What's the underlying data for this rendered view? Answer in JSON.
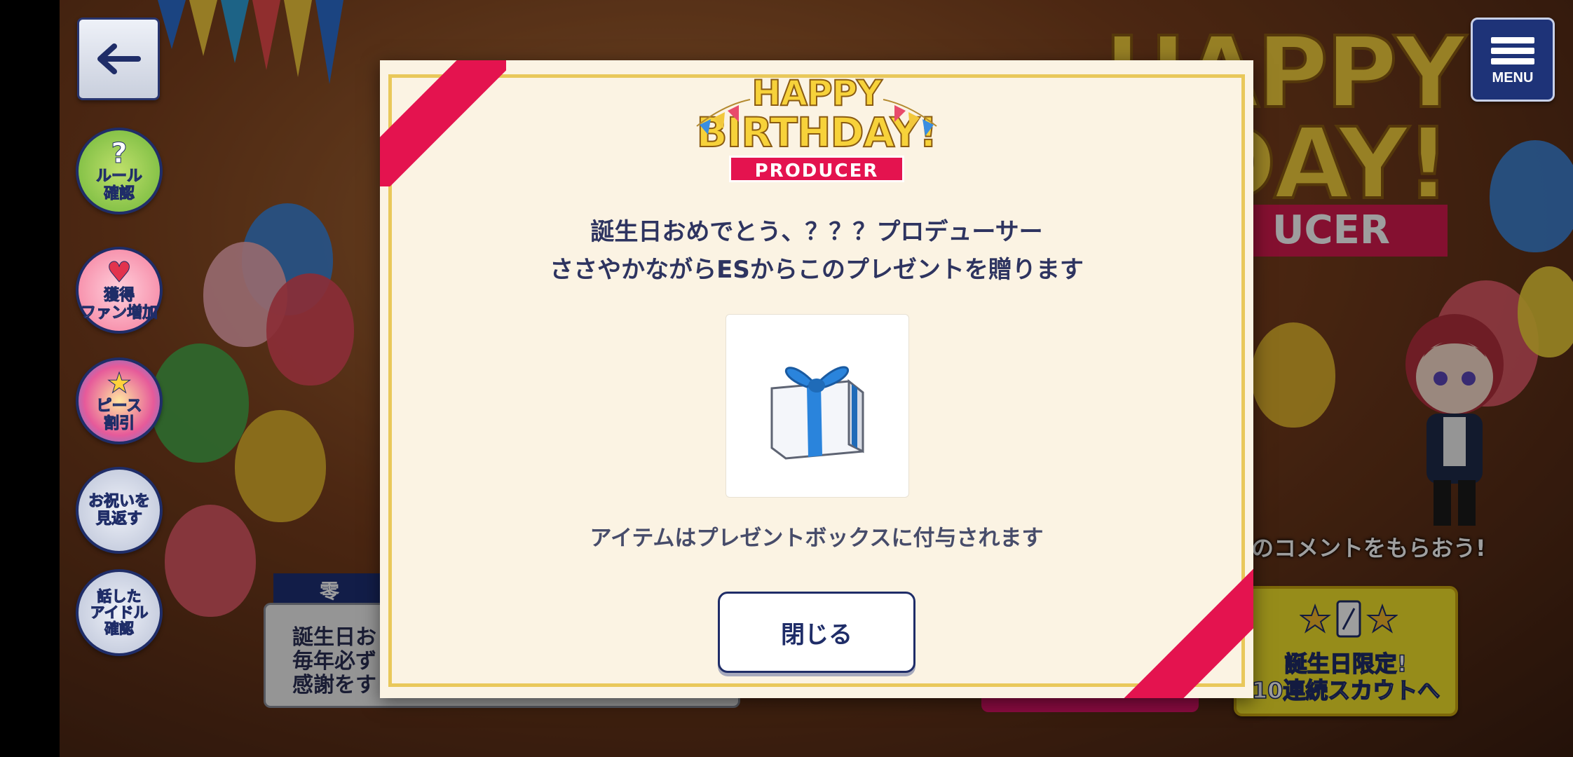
{
  "menu": {
    "label": "MENU"
  },
  "side_buttons": [
    {
      "label": "ルール\n確認",
      "icon": "question-icon"
    },
    {
      "label": "獲得\nファン増加",
      "icon": "heart-icon"
    },
    {
      "label": "ピース\n割引",
      "icon": "star-gem-icon"
    },
    {
      "label": "お祝いを\n見返す",
      "icon": "none"
    },
    {
      "label": "話した\nアイドル\n確認",
      "icon": "none"
    }
  ],
  "speaker": {
    "name": "零",
    "lines": "誕生日お\n毎年必ず\n感謝をす"
  },
  "background": {
    "logo_top": "HAPPY",
    "logo_bottom": "DAY!",
    "logo_ribbon": "UCER",
    "comment_text": "のコメントをもらおう!",
    "scout_button": "誕生日限定!\n10連続スカウトへ"
  },
  "modal": {
    "logo": {
      "line1": "HAPPY",
      "line2": "BIRTHDAY!",
      "ribbon": "PRODUCER"
    },
    "message_line1": "誕生日おめでとう、？？？プロデューサー",
    "message_line2": "ささやかながらESからこのプレゼントを贈ります",
    "gift_icon": "gift-box-icon",
    "note": "アイテムはプレゼントボックスに付与されます",
    "close_label": "閉じる"
  },
  "colors": {
    "navy": "#1f2d68",
    "ribbon_pink": "#e4134f",
    "modal_bg": "#fbf3e3",
    "gold": "#e9c85a"
  }
}
